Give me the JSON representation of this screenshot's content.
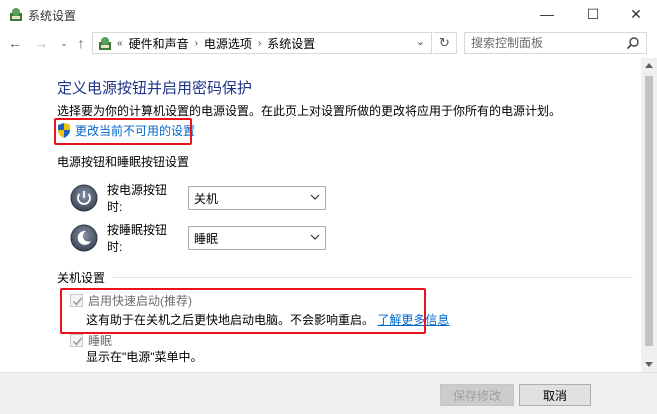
{
  "window": {
    "title": "系统设置",
    "minimize_glyph": "—",
    "maximize_glyph": "☐",
    "close_glyph": "✕"
  },
  "nav": {
    "back_glyph": "←",
    "forward_glyph": "→",
    "recent_glyph": "⌄",
    "up_glyph": "↑",
    "refresh_glyph": "↻",
    "breadcrumb_prefix": "«",
    "breadcrumb": [
      "硬件和声音",
      "电源选项",
      "系统设置"
    ],
    "breadcrumb_sep": "›",
    "dropdown_glyph": "⌄",
    "search_placeholder": "搜索控制面板"
  },
  "main": {
    "title": "定义电源按钮并启用密码保护",
    "subtitle": "选择要为你的计算机设置的电源设置。在此页上对设置所做的更改将应用于你所有的电源计划。",
    "change_link": "更改当前不可用的设置",
    "power_section": {
      "label": "电源按钮和睡眠按钮设置",
      "rows": [
        {
          "label": "按电源按钮时:",
          "value": "关机",
          "icon": "power-icon"
        },
        {
          "label": "按睡眠按钮时:",
          "value": "睡眠",
          "icon": "sleep-icon"
        }
      ]
    },
    "shutdown_section": {
      "label": "关机设置",
      "fast_startup": {
        "label": "启用快速启动(推荐)",
        "checked": true,
        "enabled": false,
        "desc": "这有助于在关机之后更快地启动电脑。不会影响重启。",
        "link": "了解更多信息"
      },
      "sleep": {
        "label": "睡眠",
        "checked": true,
        "enabled": false,
        "desc": "显示在\"电源\"菜单中。"
      }
    }
  },
  "footer": {
    "save_label": "保存修改",
    "save_enabled": false,
    "cancel_label": "取消"
  },
  "colors": {
    "title_blue": "#1e3287",
    "link_blue": "#0066cc",
    "highlight_red": "#e8131b"
  }
}
